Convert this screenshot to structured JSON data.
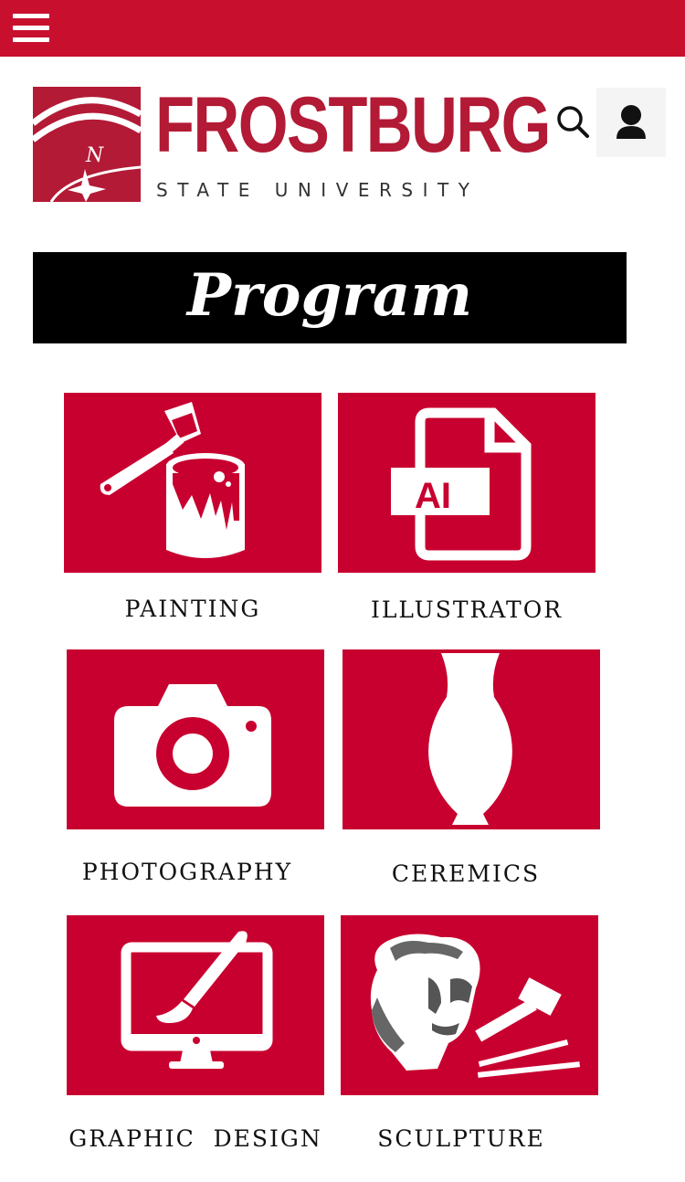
{
  "header": {
    "menu_icon": "hamburger-menu-icon",
    "search_icon": "search-icon",
    "user_icon": "user-icon",
    "brand_color": "#c8102e"
  },
  "logo": {
    "name": "FROSTBURG",
    "subtitle": "STATE UNIVERSITY"
  },
  "page": {
    "title": "Program"
  },
  "programs": [
    {
      "label": "PAINTING",
      "icon": "paint-bucket-brush-icon"
    },
    {
      "label": "ILLUSTRATOR",
      "icon": "ai-file-icon"
    },
    {
      "label": "PHOTOGRAPHY",
      "icon": "camera-icon"
    },
    {
      "label": "CEREMICS",
      "icon": "vase-icon"
    },
    {
      "label": "GRAPHIC  DESIGN",
      "icon": "monitor-brush-icon"
    },
    {
      "label": "SCULPTURE",
      "icon": "sculpture-tools-icon"
    }
  ],
  "tile_color": "#c8002f"
}
